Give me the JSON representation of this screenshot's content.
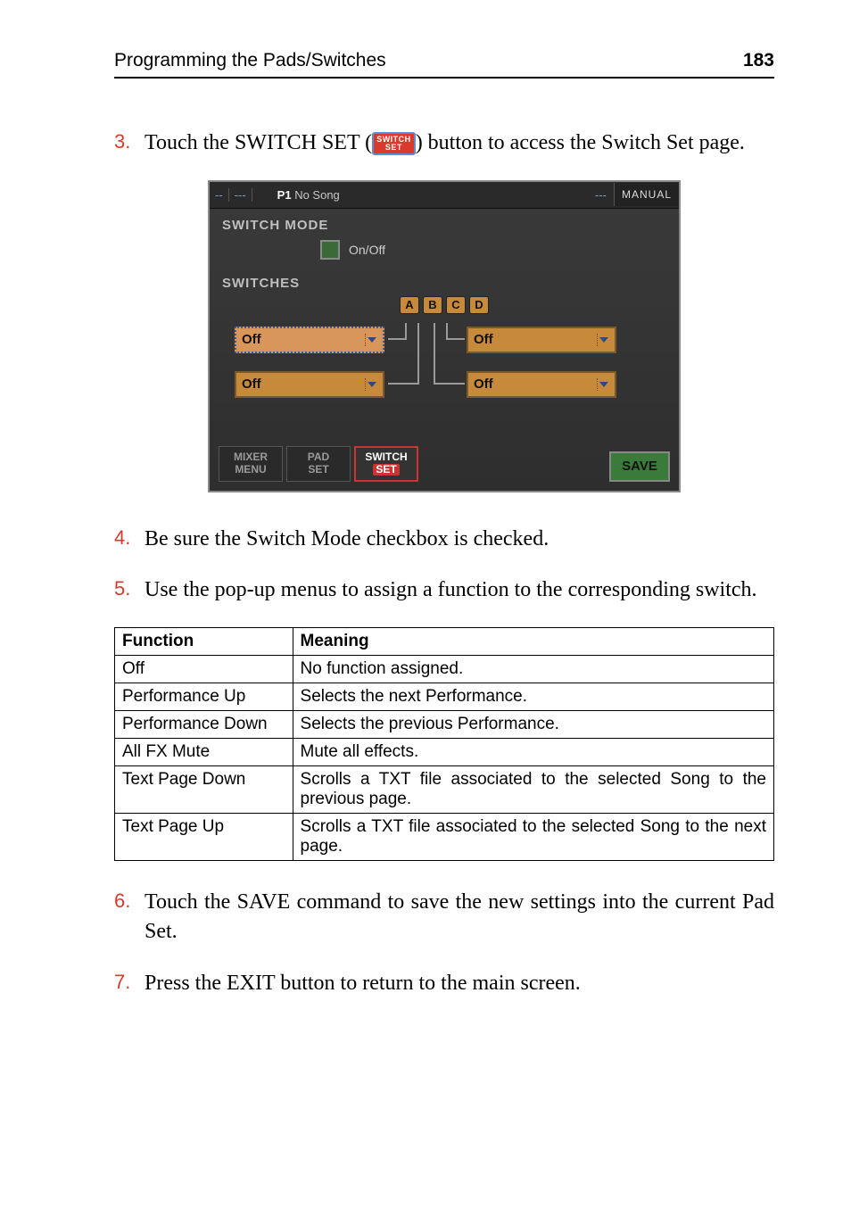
{
  "header": {
    "title": "Programming the Pads/Switches",
    "page": "183"
  },
  "steps": {
    "s3": {
      "num": "3.",
      "pre": "Touch the SWITCH SET (",
      "post": ") button to access the Switch Set page.",
      "icon_l1": "SWITCH",
      "icon_l2": "SET"
    },
    "s4": {
      "num": "4.",
      "text": "Be sure the Switch Mode checkbox is checked."
    },
    "s5": {
      "num": "5.",
      "text": "Use the pop-up menus to assign a function to the corresponding switch."
    },
    "s6": {
      "num": "6.",
      "text": "Touch the SAVE command to save the new settings into the current Pad Set."
    },
    "s7": {
      "num": "7.",
      "text": "Press the EXIT button to return to the main screen."
    }
  },
  "screenshot": {
    "top": {
      "dash1": "--",
      "dash2": "---",
      "title_prefix": "P1",
      "title_rest": " No Song",
      "dash3": "---",
      "manual": "MANUAL"
    },
    "switch_mode_label": "SWITCH MODE",
    "onoff": "On/Off",
    "switches_label": "SWITCHES",
    "abcd": [
      "A",
      "B",
      "C",
      "D"
    ],
    "switches": {
      "a": "Off",
      "b": "Off",
      "c": "Off",
      "d": "Off"
    },
    "tabs": {
      "mixer_l1": "MIXER",
      "mixer_l2": "MENU",
      "pad_l1": "PAD",
      "pad_l2": "SET",
      "switch_l1": "SWITCH",
      "switch_l2": "SET"
    },
    "save": "SAVE"
  },
  "table": {
    "head": {
      "c1": "Function",
      "c2": "Meaning"
    },
    "rows": [
      {
        "f": "Off",
        "m": "No function assigned."
      },
      {
        "f": "Performance Up",
        "m": "Selects the next Performance."
      },
      {
        "f": "Performance Down",
        "m": "Selects the previous Performance."
      },
      {
        "f": "All FX Mute",
        "m": "Mute all effects."
      },
      {
        "f": "Text Page Down",
        "m": "Scrolls a TXT file associated to the selected Song to the previous page."
      },
      {
        "f": "Text Page Up",
        "m": "Scrolls a TXT file associated to the selected Song to the next page."
      }
    ]
  }
}
